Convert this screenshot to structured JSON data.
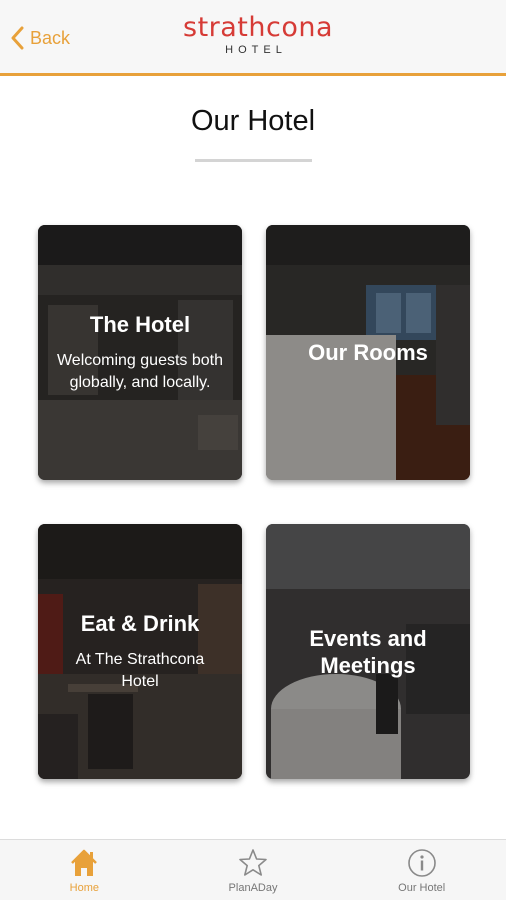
{
  "header": {
    "back_label": "Back",
    "logo_main": "strathcona",
    "logo_sub": "HOTEL"
  },
  "page": {
    "title": "Our Hotel"
  },
  "cards": [
    {
      "title": "The Hotel",
      "subtitle": "Welcoming guests both globally, and locally."
    },
    {
      "title": "Our Rooms",
      "subtitle": ""
    },
    {
      "title": "Eat & Drink",
      "subtitle": "At The Strathcona Hotel"
    },
    {
      "title": "Events and Meetings",
      "subtitle": ""
    }
  ],
  "tabbar": {
    "tabs": [
      {
        "label": "Home",
        "icon": "home-icon",
        "active": true
      },
      {
        "label": "PlanADay",
        "icon": "star-icon",
        "active": false
      },
      {
        "label": "Our Hotel",
        "icon": "info-icon",
        "active": false
      }
    ]
  },
  "colors": {
    "accent": "#e8a13a",
    "brand": "#d63b36"
  }
}
